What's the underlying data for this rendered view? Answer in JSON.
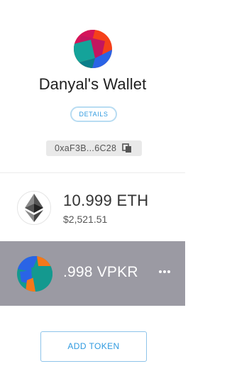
{
  "wallet": {
    "name": "Danyal's Wallet",
    "details_label": "DETAILS",
    "address_short": "0xaF3B...6C28"
  },
  "tokens": [
    {
      "symbol": "ETH",
      "balance": "10.999 ETH",
      "fiat": "$2,521.51",
      "icon": "ethereum-icon"
    },
    {
      "symbol": "VPKR",
      "balance": ".998 VPKR",
      "icon": "token-identicon",
      "menu_icon": "more-horizontal-icon"
    }
  ],
  "actions": {
    "add_token_label": "ADD TOKEN"
  },
  "colors": {
    "accent": "#2f9ae0",
    "selected_row": "#9b9aa3",
    "address_chip": "#e9e9e9"
  }
}
